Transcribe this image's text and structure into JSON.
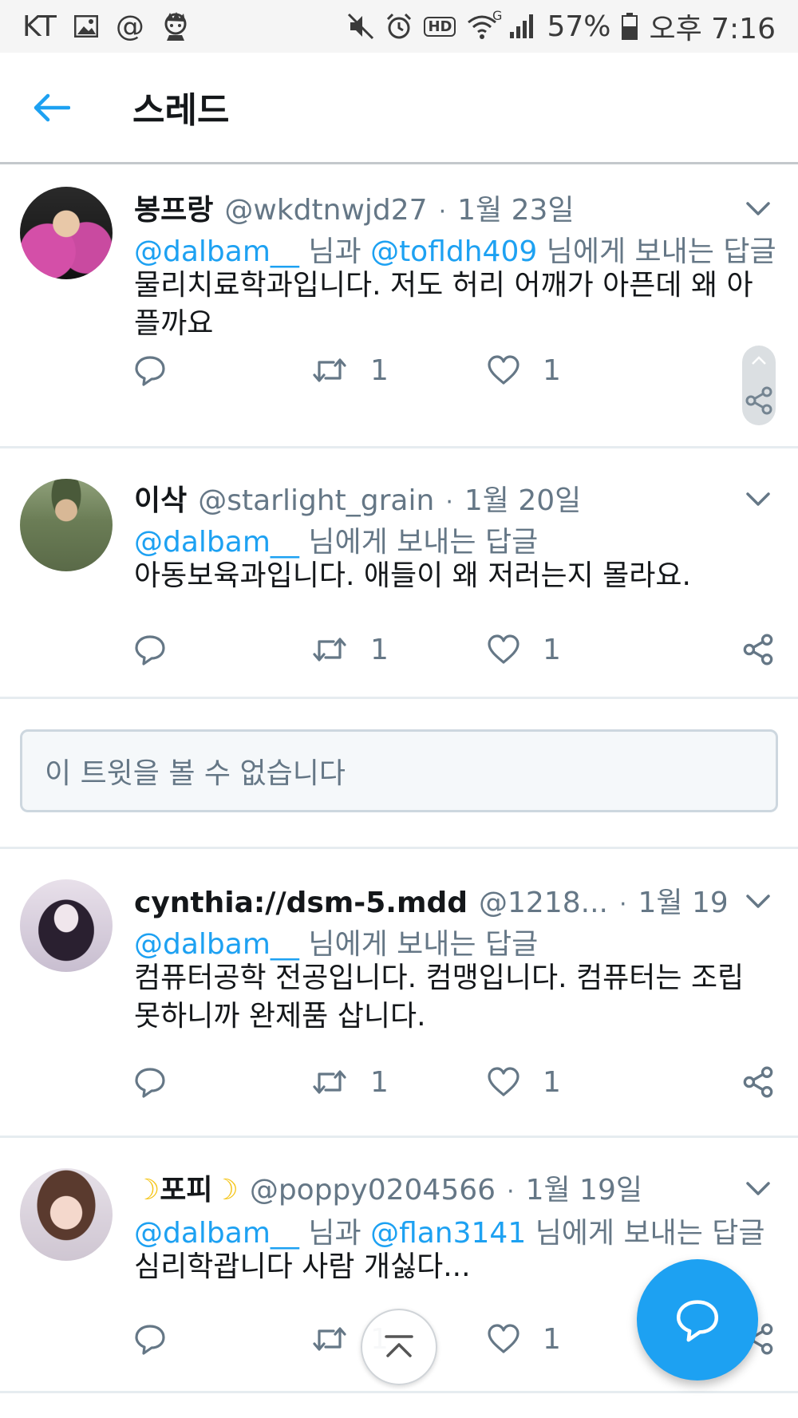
{
  "status_bar": {
    "carrier": "KT",
    "at_symbol": "@",
    "hd_label": "HD",
    "network_label": "G",
    "battery": "57%",
    "time": "오후 7:16"
  },
  "header": {
    "title": "스레드"
  },
  "tweets": [
    {
      "name": "봉프랑",
      "handle": "@wkdtnwjd27",
      "dot": "·",
      "date": "1월 23일",
      "mentions": [
        "@dalbam__",
        "@tofldh409"
      ],
      "connector": "님과",
      "reply_suffix": "님에게 보내는 답글",
      "body_lines": [
        "물리치료학과입니다. 저도 허리 어깨가 아픈데 왜 아",
        "플까요"
      ],
      "retweets": "1",
      "likes": "1"
    },
    {
      "name": "이삭",
      "handle": "@starlight_grain",
      "dot": "·",
      "date": "1월 20일",
      "mentions": [
        "@dalbam__"
      ],
      "reply_suffix": "님에게 보내는 답글",
      "body_lines": [
        "아동보육과입니다. 애들이 왜 저러는지 몰라요."
      ],
      "retweets": "1",
      "likes": "1"
    },
    {
      "name": "cynthia://dsm-5.mdd",
      "handle": "@1218...",
      "dot": "·",
      "date": "1월 19일",
      "mentions": [
        "@dalbam__"
      ],
      "reply_suffix": "님에게 보내는 답글",
      "body_lines": [
        "컴퓨터공학 전공입니다. 컴맹입니다. 컴퓨터는 조립",
        "못하니까 완제품 삽니다."
      ],
      "retweets": "1",
      "likes": "1"
    },
    {
      "name": "포피",
      "handle": "@poppy0204566",
      "dot": "·",
      "date": "1월 19일",
      "mentions": [
        "@dalbam__",
        "@flan3141"
      ],
      "connector": "님과",
      "reply_suffix": "님에게 보내는 답글",
      "body_lines": [
        "심리학괍니다 사람 개싫다..."
      ],
      "retweets": "1",
      "likes": "1"
    }
  ],
  "unavailable": {
    "text": "이 트윗을 볼 수 없습니다"
  },
  "colors": {
    "accent": "#1da1f2",
    "secondary_text": "#657786",
    "primary_text": "#14171a",
    "divider": "#e6ecf0"
  },
  "icons": {
    "back": "arrow-left-icon",
    "reply": "speech-bubble-icon",
    "retweet": "retweet-arrows-icon",
    "like": "heart-icon",
    "share": "share-nodes-icon",
    "compose": "compose-reply-icon",
    "scroll_top": "double-chevron-up-icon"
  }
}
